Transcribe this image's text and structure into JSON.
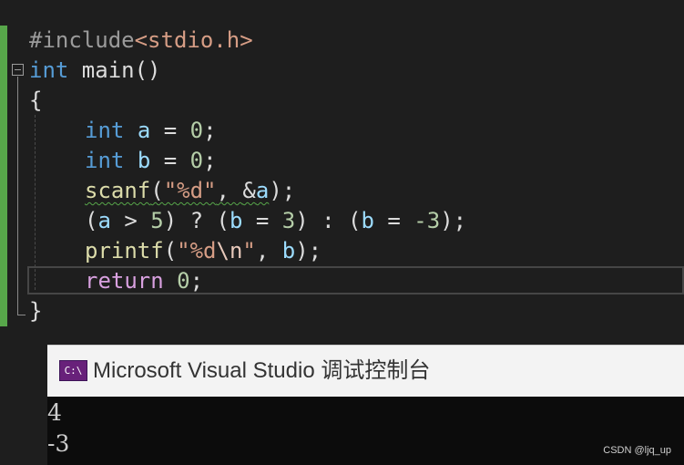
{
  "editor": {
    "line1": {
      "directive": "#include",
      "header": "<stdio.h>"
    },
    "line2": {
      "type": "int",
      "name": " main()"
    },
    "line3": {
      "brace": "{"
    },
    "line4": {
      "type": "int",
      "var": "a",
      "eq": " = ",
      "num": "0",
      "end": ";"
    },
    "line5": {
      "type": "int",
      "var": "b",
      "eq": " = ",
      "num": "0",
      "end": ";"
    },
    "line6": {
      "fn": "scanf",
      "open": "(",
      "str": "\"%d\"",
      "comma": ", ",
      "amp": "&",
      "var": "a",
      "end": ");"
    },
    "line7": {
      "p1": "(",
      "v1": "a",
      "op1": " > ",
      "n1": "5",
      "p2": ") ? (",
      "v2": "b",
      "op2": " = ",
      "n2": "3",
      "p3": ") : (",
      "v3": "b",
      "op3": " = ",
      "n3": "-3",
      "p4": ");"
    },
    "line8": {
      "fn": "printf",
      "open": "(",
      "str1": "\"%d",
      "esc": "\\n",
      "str2": "\"",
      "comma": ", ",
      "var": "b",
      "end": ");"
    },
    "line9": {
      "kw": "return",
      "num": "0",
      "end": ";"
    },
    "line10": {
      "brace": "}"
    }
  },
  "console": {
    "icon_text": "C:\\",
    "title": "Microsoft Visual Studio 调试控制台",
    "output": [
      "4",
      "-3"
    ]
  },
  "watermark": "CSDN @ljq_up",
  "colors": {
    "keyword": "#569cd6",
    "control_keyword": "#d8a0df",
    "string": "#d69d85",
    "number": "#b5cea8",
    "function": "#dcdcaa",
    "variable": "#9cdcfe",
    "change_bar": "#57a64a"
  }
}
